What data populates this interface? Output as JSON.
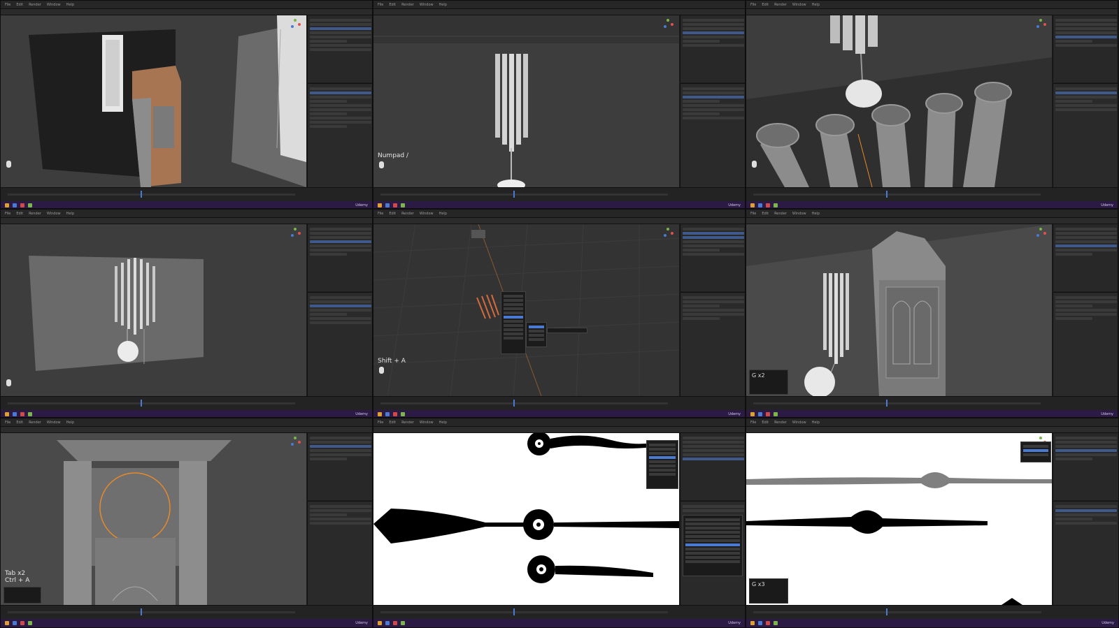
{
  "panels": [
    {
      "id": 1,
      "overlay": ""
    },
    {
      "id": 2,
      "overlay": "Numpad /"
    },
    {
      "id": 3,
      "overlay": ""
    },
    {
      "id": 4,
      "overlay": ""
    },
    {
      "id": 5,
      "overlay": "Shift + A"
    },
    {
      "id": 6,
      "overlay": "G x2"
    },
    {
      "id": 7,
      "overlay": "Tab x2\nCtrl + A"
    },
    {
      "id": 8,
      "overlay": ""
    },
    {
      "id": 9,
      "overlay": "G x3"
    }
  ],
  "taskbar_label": "Udemy",
  "colors": {
    "taskbar": "#2a1a44",
    "viewport": "#3d3d3d",
    "selection": "#e58a2c",
    "accent": "#4a7ad1"
  }
}
